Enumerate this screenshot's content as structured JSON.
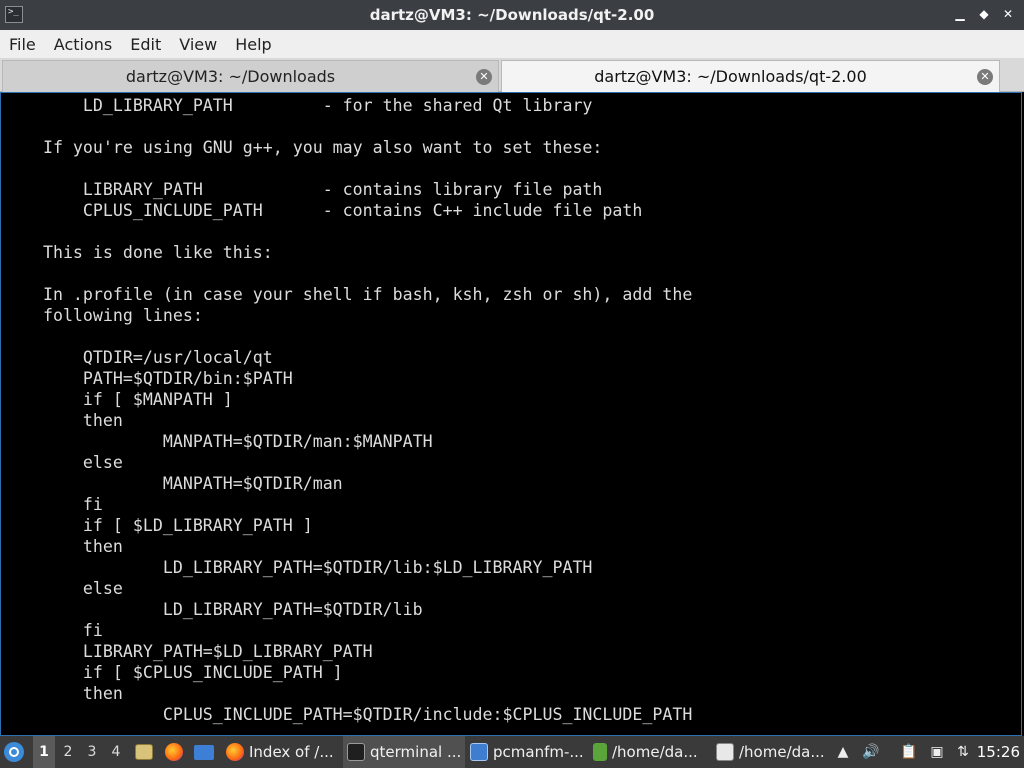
{
  "window": {
    "title": "dartz@VM3: ~/Downloads/qt-2.00",
    "app_icon": ">_",
    "controls": {
      "minimize": "▁",
      "maximize": "◆",
      "close": "✕"
    }
  },
  "menu": [
    "File",
    "Actions",
    "Edit",
    "View",
    "Help"
  ],
  "tabs": [
    {
      "label": "dartz@VM3: ~/Downloads",
      "close": "✕",
      "active": false
    },
    {
      "label": "dartz@VM3: ~/Downloads/qt-2.00",
      "close": "✕",
      "active": true
    }
  ],
  "terminal": {
    "lines": [
      "        LD_LIBRARY_PATH         - for the shared Qt library",
      "",
      "    If you're using GNU g++, you may also want to set these:",
      "",
      "        LIBRARY_PATH            - contains library file path",
      "        CPLUS_INCLUDE_PATH      - contains C++ include file path",
      "",
      "    This is done like this:",
      "",
      "    In .profile (in case your shell if bash, ksh, zsh or sh), add the",
      "    following lines:",
      "",
      "        QTDIR=/usr/local/qt",
      "        PATH=$QTDIR/bin:$PATH",
      "        if [ $MANPATH ]",
      "        then",
      "                MANPATH=$QTDIR/man:$MANPATH",
      "        else",
      "                MANPATH=$QTDIR/man",
      "        fi",
      "        if [ $LD_LIBRARY_PATH ]",
      "        then",
      "                LD_LIBRARY_PATH=$QTDIR/lib:$LD_LIBRARY_PATH",
      "        else",
      "                LD_LIBRARY_PATH=$QTDIR/lib",
      "        fi",
      "        LIBRARY_PATH=$LD_LIBRARY_PATH",
      "        if [ $CPLUS_INCLUDE_PATH ]",
      "        then",
      "                CPLUS_INCLUDE_PATH=$QTDIR/include:$CPLUS_INCLUDE_PATH"
    ]
  },
  "taskbar": {
    "desktops": [
      "1",
      "2",
      "3",
      "4"
    ],
    "quick_launch": [
      "file-manager-icon",
      "firefox-icon",
      "desktop-icon"
    ],
    "tasks": [
      {
        "label": "Index of /...",
        "icon": "firefox-icon"
      },
      {
        "label": "qterminal ...",
        "icon": "terminal-icon"
      },
      {
        "label": "pcmanfm-...",
        "icon": "folder-icon"
      },
      {
        "label": "/home/da...",
        "icon": "text-file-icon"
      },
      {
        "label": "/home/da...",
        "icon": "text-editor-icon"
      }
    ],
    "tray": [
      "scroll-icon",
      "volume-icon",
      "clipboard-icon",
      "screen-icon",
      "network-icon"
    ],
    "tray_glyphs": [
      "▲",
      "🔊",
      "📋",
      "▣",
      "⇅"
    ],
    "clock": "15:26"
  }
}
